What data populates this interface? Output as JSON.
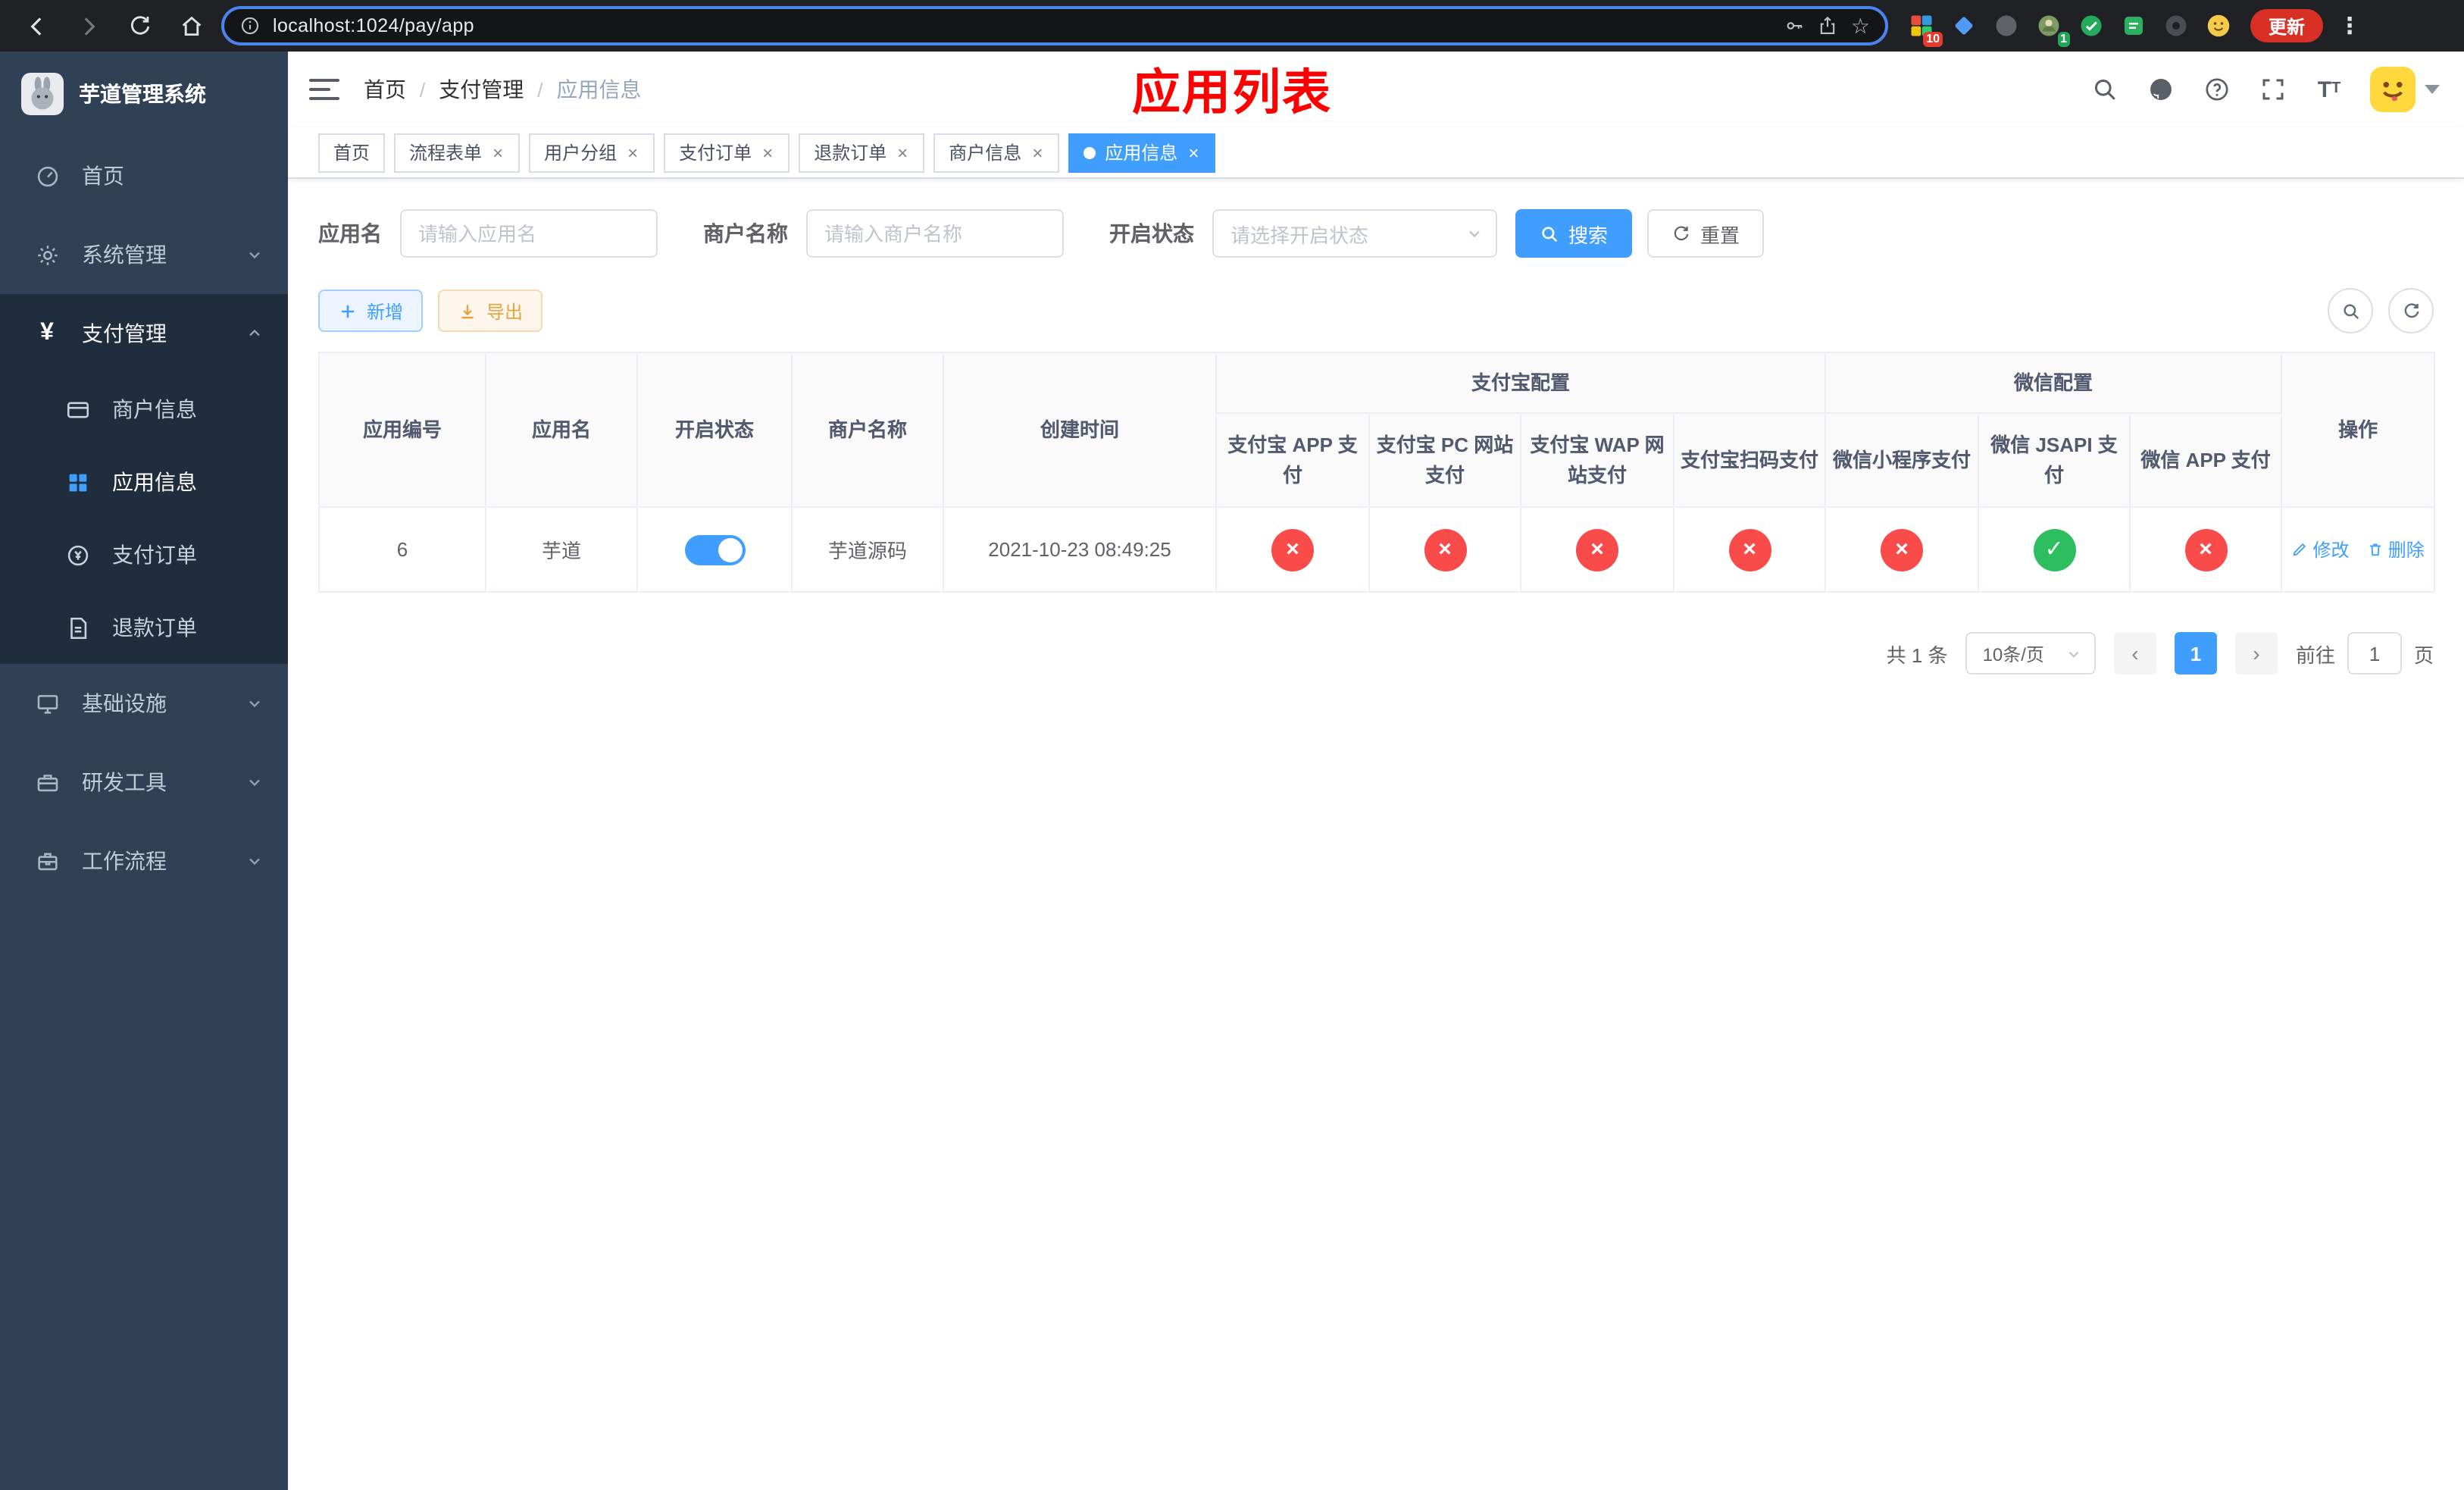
{
  "colors": {
    "accent": "#409eff",
    "danger": "#fa4b4b",
    "success": "#2dbe60",
    "annotation": "#ff0000",
    "update": "#d93025"
  },
  "browser": {
    "url": "localhost:1024/pay/app",
    "update_button": "更新",
    "ext_badges": [
      "10",
      "1"
    ]
  },
  "sidebar": {
    "logo_title": "芋道管理系统",
    "menu": [
      {
        "label": "首页"
      },
      {
        "label": "系统管理"
      },
      {
        "label": "支付管理"
      },
      {
        "label": "基础设施"
      },
      {
        "label": "研发工具"
      },
      {
        "label": "工作流程"
      }
    ],
    "submenu": [
      {
        "label": "商户信息"
      },
      {
        "label": "应用信息"
      },
      {
        "label": "支付订单"
      },
      {
        "label": "退款订单"
      }
    ]
  },
  "header": {
    "breadcrumb": [
      "首页",
      "支付管理",
      "应用信息"
    ],
    "annotation": "应用列表"
  },
  "tabs": [
    {
      "label": "首页"
    },
    {
      "label": "流程表单"
    },
    {
      "label": "用户分组"
    },
    {
      "label": "支付订单"
    },
    {
      "label": "退款订单"
    },
    {
      "label": "商户信息"
    },
    {
      "label": "应用信息"
    }
  ],
  "filters": {
    "app_name_label": "应用名",
    "app_name_placeholder": "请输入应用名",
    "merchant_label": "商户名称",
    "merchant_placeholder": "请输入商户名称",
    "status_label": "开启状态",
    "status_placeholder": "请选择开启状态",
    "search_button": "搜索",
    "reset_button": "重置"
  },
  "toolbar": {
    "add_button": "新增",
    "export_button": "导出"
  },
  "table": {
    "group_headers": {
      "alipay": "支付宝配置",
      "wechat": "微信配置"
    },
    "columns": [
      "应用编号",
      "应用名",
      "开启状态",
      "商户名称",
      "创建时间",
      "支付宝 APP 支付",
      "支付宝 PC 网站支付",
      "支付宝 WAP 网站支付",
      "支付宝扫码支付",
      "微信小程序支付",
      "微信 JSAPI 支付",
      "微信 APP 支付",
      "操作"
    ],
    "rows": [
      {
        "id": "6",
        "app_name": "芋道",
        "enabled": true,
        "merchant_name": "芋道源码",
        "created_at": "2021-10-23 08:49:25",
        "pay_configs": [
          false,
          false,
          false,
          false,
          false,
          true,
          false
        ],
        "edit_label": "修改",
        "delete_label": "删除"
      }
    ]
  },
  "pagination": {
    "total_text": "共 1 条",
    "page_size": "10条/页",
    "current_page": "1",
    "goto_label": "前往",
    "goto_value": "1",
    "page_unit": "页"
  }
}
